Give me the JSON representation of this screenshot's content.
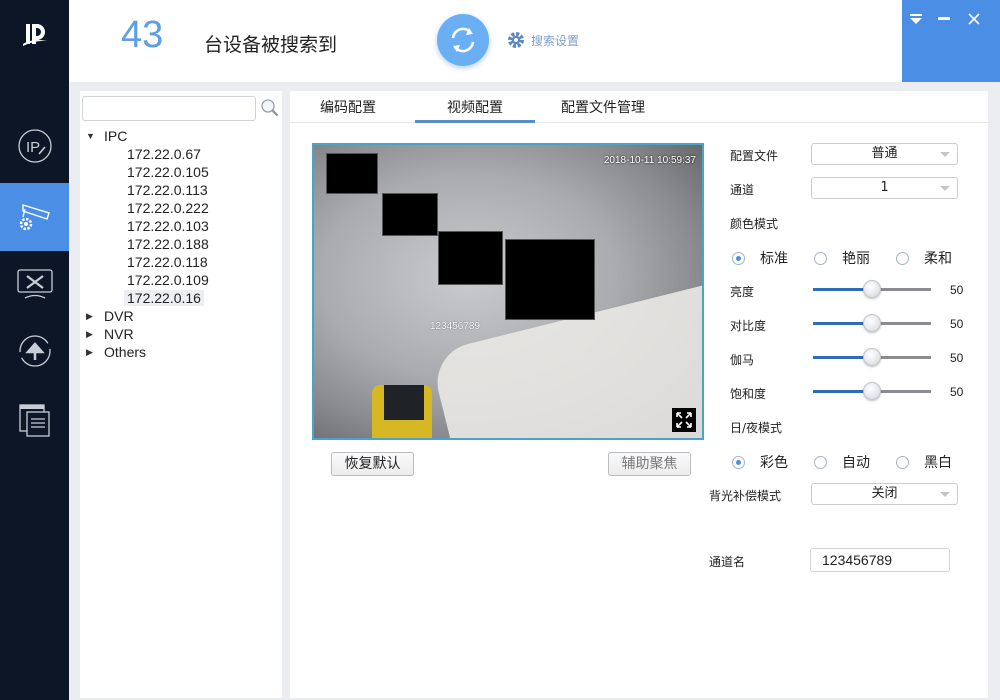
{
  "header": {
    "device_count": "43",
    "device_count_label": "台设备被搜索到",
    "search_settings_label": "搜索设置",
    "accent_color": "#4a8ee6"
  },
  "window_controls": {
    "menu_icon": "dropdown-triangle-icon",
    "minimize_icon": "minimize-icon",
    "close_icon": "close-icon"
  },
  "nav": {
    "items": [
      {
        "name": "ip-modify",
        "icon": "ip-edit-icon",
        "active": false
      },
      {
        "name": "device-config",
        "icon": "camera-gear-icon",
        "active": true
      },
      {
        "name": "maintenance",
        "icon": "tools-monitor-icon",
        "active": false
      },
      {
        "name": "upgrade",
        "icon": "upload-cycle-icon",
        "active": false
      },
      {
        "name": "documents",
        "icon": "document-stack-icon",
        "active": false
      }
    ]
  },
  "device_tree": {
    "search_placeholder": "",
    "groups": [
      {
        "label": "IPC",
        "expanded": true,
        "children": [
          "172.22.0.67",
          "172.22.0.105",
          "172.22.0.113",
          "172.22.0.222",
          "172.22.0.103",
          "172.22.0.188",
          "172.22.0.118",
          "172.22.0.109",
          "172.22.0.16"
        ],
        "selected": "172.22.0.16"
      },
      {
        "label": "DVR",
        "expanded": false
      },
      {
        "label": "NVR",
        "expanded": false
      },
      {
        "label": "Others",
        "expanded": false
      }
    ]
  },
  "tabs": [
    {
      "label": "编码配置",
      "active": false
    },
    {
      "label": "视频配置",
      "active": true
    },
    {
      "label": "配置文件管理",
      "active": false
    }
  ],
  "preview": {
    "timestamp": "2018-10-11 10:59:37",
    "osd_text": "123456789",
    "fullscreen_icon": "fullscreen-icon"
  },
  "buttons": {
    "restore_default": "恢复默认",
    "assist_focus": "辅助聚焦"
  },
  "settings": {
    "profile": {
      "label": "配置文件",
      "value": "普通"
    },
    "channel": {
      "label": "通道",
      "value": "1"
    },
    "color_mode": {
      "label": "颜色模式",
      "options": [
        "标准",
        "艳丽",
        "柔和"
      ],
      "selected": "标准"
    },
    "sliders": [
      {
        "label": "亮度",
        "value": 50,
        "min": 0,
        "max": 100
      },
      {
        "label": "对比度",
        "value": 50,
        "min": 0,
        "max": 100
      },
      {
        "label": "伽马",
        "value": 50,
        "min": 0,
        "max": 100
      },
      {
        "label": "饱和度",
        "value": 50,
        "min": 0,
        "max": 100
      }
    ],
    "day_night": {
      "label": "日/夜模式",
      "options": [
        "彩色",
        "自动",
        "黑白"
      ],
      "selected": "彩色"
    },
    "backlight": {
      "label": "背光补偿模式",
      "value": "关闭"
    },
    "channel_name": {
      "label": "通道名",
      "value": "123456789"
    }
  }
}
